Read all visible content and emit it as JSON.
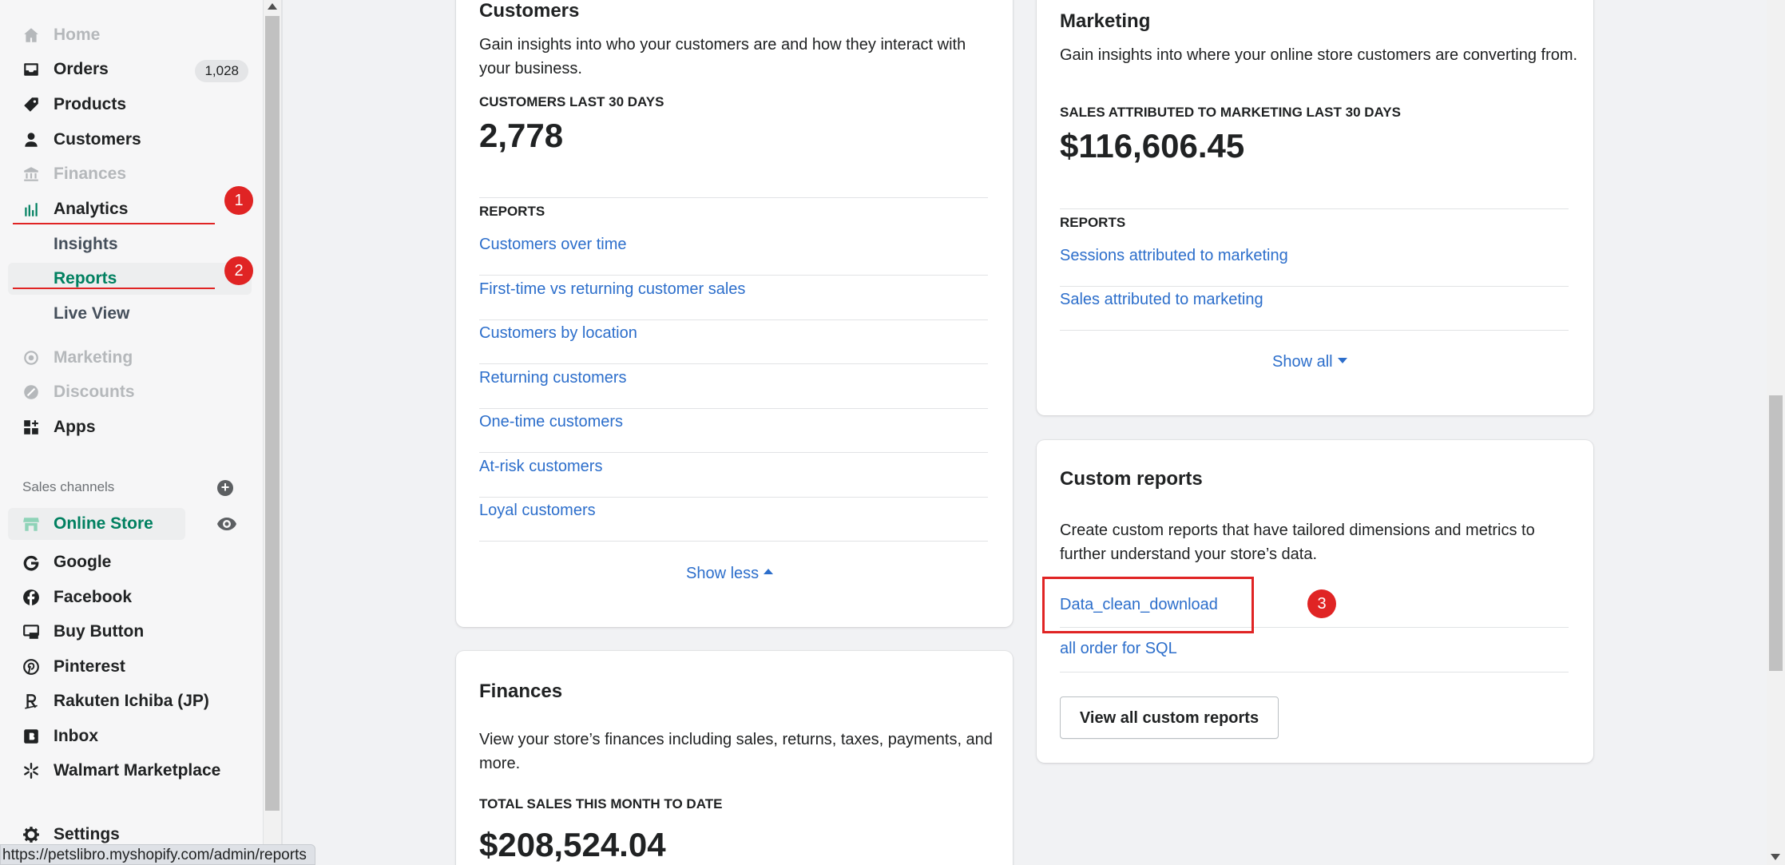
{
  "sidebar": {
    "items": [
      {
        "label": "Home",
        "icon": "home-icon"
      },
      {
        "label": "Orders",
        "icon": "orders-icon",
        "badge": "1,028"
      },
      {
        "label": "Products",
        "icon": "tag-icon"
      },
      {
        "label": "Customers",
        "icon": "person-icon"
      },
      {
        "label": "Finances",
        "icon": "bank-icon"
      },
      {
        "label": "Analytics",
        "icon": "bar-chart-icon"
      },
      {
        "label": "Insights"
      },
      {
        "label": "Reports"
      },
      {
        "label": "Live View"
      },
      {
        "label": "Marketing",
        "icon": "target-icon"
      },
      {
        "label": "Discounts",
        "icon": "discount-icon"
      },
      {
        "label": "Apps",
        "icon": "apps-icon"
      }
    ],
    "sales_channels_title": "Sales channels",
    "channels": [
      {
        "label": "Online Store",
        "icon": "store-icon"
      },
      {
        "label": "Google",
        "icon": "google-icon"
      },
      {
        "label": "Facebook",
        "icon": "facebook-icon"
      },
      {
        "label": "Buy Button",
        "icon": "buy-button-icon"
      },
      {
        "label": "Pinterest",
        "icon": "pinterest-icon"
      },
      {
        "label": "Rakuten Ichiba (JP)",
        "icon": "rakuten-icon"
      },
      {
        "label": "Inbox",
        "icon": "inbox-icon"
      },
      {
        "label": "Walmart Marketplace",
        "icon": "walmart-icon"
      }
    ],
    "settings": "Settings"
  },
  "customers_card": {
    "title": "Customers",
    "description": "Gain insights into who your customers are and how they interact with your business.",
    "metric_label": "CUSTOMERS LAST 30 DAYS",
    "metric_value": "2,778",
    "reports_label": "REPORTS",
    "reports": [
      "Customers over time",
      "First-time vs returning customer sales",
      "Customers by location",
      "Returning customers",
      "One-time customers",
      "At-risk customers",
      "Loyal customers"
    ],
    "toggle": "Show less"
  },
  "finances_card": {
    "title": "Finances",
    "description": "View your store’s finances including sales, returns, taxes, payments, and more.",
    "metric_label": "TOTAL SALES THIS MONTH TO DATE",
    "metric_value": "$208,524.04"
  },
  "marketing_card": {
    "title": "Marketing",
    "description": "Gain insights into where your online store customers are converting from.",
    "metric_label": "SALES ATTRIBUTED TO MARKETING LAST 30 DAYS",
    "metric_value": "$116,606.45",
    "reports_label": "REPORTS",
    "reports": [
      "Sessions attributed to marketing",
      "Sales attributed to marketing"
    ],
    "toggle": "Show all"
  },
  "custom_reports_card": {
    "title": "Custom reports",
    "description": "Create custom reports that have tailored dimensions and metrics to further understand your store’s data.",
    "reports": [
      "Data_clean_download",
      "all order for SQL"
    ],
    "button": "View all custom reports"
  },
  "annotations": {
    "step1": "1",
    "step2": "2",
    "step3": "3",
    "color": "#e02424"
  },
  "status_bar": {
    "url": "https://petslibro.myshopify.com/admin/reports"
  },
  "colors": {
    "link": "#2c6ecb",
    "active": "#008060"
  }
}
